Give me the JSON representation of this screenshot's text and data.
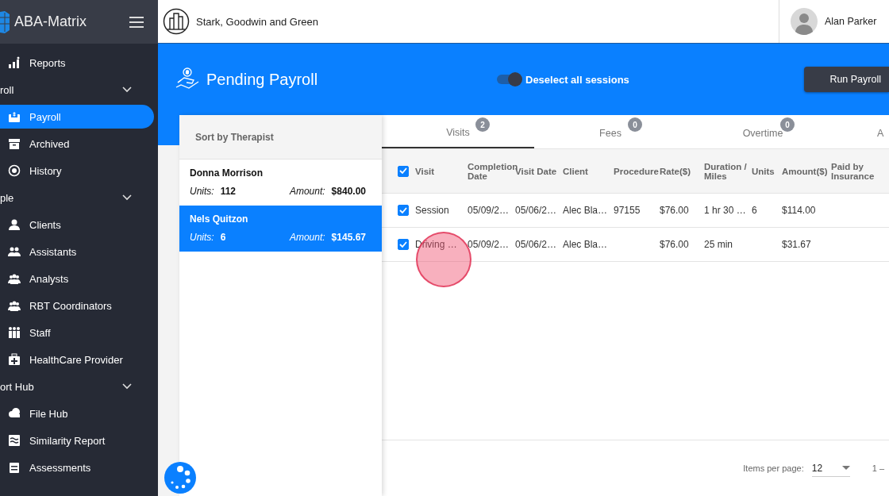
{
  "app": {
    "name": "ABA-Matrix"
  },
  "sidebar": {
    "items": [
      {
        "kind": "item",
        "label": "Reports",
        "selected": false
      },
      {
        "kind": "section",
        "label": "roll",
        "expanded": true
      },
      {
        "kind": "item",
        "label": "Payroll",
        "selected": true
      },
      {
        "kind": "item",
        "label": "Archived",
        "selected": false
      },
      {
        "kind": "item",
        "label": "History",
        "selected": false
      },
      {
        "kind": "section",
        "label": "ple",
        "expanded": true
      },
      {
        "kind": "item",
        "label": "Clients",
        "selected": false
      },
      {
        "kind": "item",
        "label": "Assistants",
        "selected": false
      },
      {
        "kind": "item",
        "label": "Analysts",
        "selected": false
      },
      {
        "kind": "item",
        "label": "RBT Coordinators",
        "selected": false
      },
      {
        "kind": "item",
        "label": "Staff",
        "selected": false
      },
      {
        "kind": "item",
        "label": "HealthCare Provider",
        "selected": false
      },
      {
        "kind": "section",
        "label": "ort Hub",
        "expanded": true
      },
      {
        "kind": "item",
        "label": "File Hub",
        "selected": false
      },
      {
        "kind": "item",
        "label": "Similarity Report",
        "selected": false
      },
      {
        "kind": "item",
        "label": "Assessments",
        "selected": false
      }
    ]
  },
  "topbar": {
    "organization": "Stark, Goodwin and Green",
    "user": "Alan Parker"
  },
  "page": {
    "title": "Pending Payroll",
    "toggle": {
      "label": "Deselect all sessions",
      "on": true
    },
    "button": "Run Payroll"
  },
  "therapists": {
    "heading": "Sort by Therapist",
    "items": [
      {
        "name": "Donna Morrison",
        "units_label": "Units:",
        "units": "112",
        "amount_label": "Amount:",
        "amount": "$840.00",
        "selected": false
      },
      {
        "name": "Nels Quitzon",
        "units_label": "Units:",
        "units": "6",
        "amount_label": "Amount:",
        "amount": "$145.67",
        "selected": true
      }
    ]
  },
  "tabs": [
    {
      "label": "Visits",
      "count": "2",
      "selected": true
    },
    {
      "label": "Fees",
      "count": "0",
      "selected": false
    },
    {
      "label": "Overtime",
      "count": "0",
      "selected": false
    },
    {
      "label": "A",
      "selected": false
    }
  ],
  "table": {
    "all_selected": true,
    "columns": [
      "Visit",
      "Completion Date",
      "Visit Date",
      "Client",
      "Procedure",
      "Rate($)",
      "Duration / Miles",
      "Units",
      "Amount($)",
      "Paid by Insurance"
    ],
    "rows": [
      {
        "selected": true,
        "cells": [
          "Session",
          "05/09/2…",
          "05/06/2…",
          "Alec Bla…",
          "97155",
          "$76.00",
          "1 hr 30 …",
          "6",
          "$114.00",
          ""
        ]
      },
      {
        "selected": true,
        "cells": [
          "Driving …",
          "05/09/2…",
          "05/06/2…",
          "Alec Bla…",
          "",
          "$76.00",
          "25 min",
          "",
          "$31.67",
          ""
        ]
      }
    ]
  },
  "pagination": {
    "label": "Items per page:",
    "page_size": "12",
    "range": "1 –"
  }
}
